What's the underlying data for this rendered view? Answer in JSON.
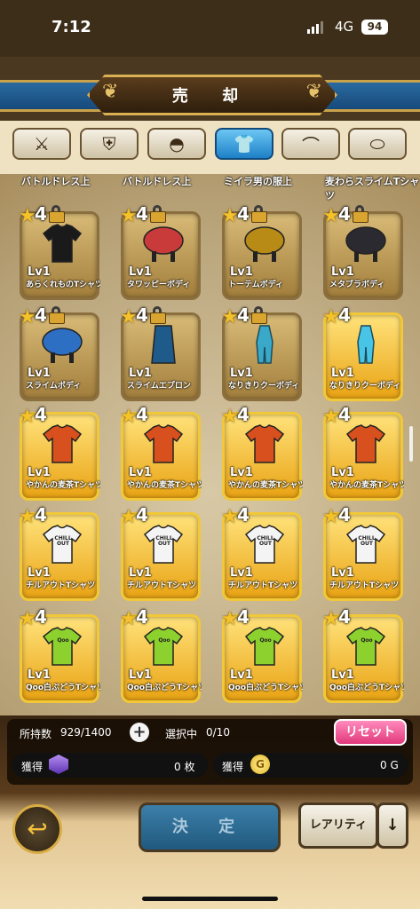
{
  "status": {
    "time": "7:12",
    "network": "4G",
    "battery": "94"
  },
  "header": {
    "title": "売 却"
  },
  "tabs": [
    {
      "icon": "sword-icon",
      "glyph": "⚔",
      "active": false
    },
    {
      "icon": "shield-icon",
      "glyph": "⛨",
      "active": false
    },
    {
      "icon": "helmet-icon",
      "glyph": "◓",
      "active": false
    },
    {
      "icon": "shirt-icon",
      "glyph": "👕",
      "active": true
    },
    {
      "icon": "pants-icon",
      "glyph": "⌒",
      "active": false
    },
    {
      "icon": "accessory-icon",
      "glyph": "⬭",
      "active": false
    }
  ],
  "partial_row": [
    "バトルドレス上",
    "バトルドレス上",
    "ミイラ男の服上",
    "麦わらスライムTシャツ"
  ],
  "items": [
    {
      "rarity": "4",
      "locked": true,
      "level": "Lv1",
      "name": "あらくれものTシャツ",
      "color": "#1a1a1a",
      "icon": "shirt-icon"
    },
    {
      "rarity": "4",
      "locked": true,
      "level": "Lv1",
      "name": "タワッピーボディ",
      "color": "#c93a3a",
      "icon": "body-icon"
    },
    {
      "rarity": "4",
      "locked": true,
      "level": "Lv1",
      "name": "トーテムボディ",
      "color": "#b88a16",
      "icon": "body-icon"
    },
    {
      "rarity": "4",
      "locked": true,
      "level": "Lv1",
      "name": "メタブラボディ",
      "color": "#2a2a30",
      "icon": "body-icon"
    },
    {
      "rarity": "4",
      "locked": true,
      "level": "Lv1",
      "name": "スライムボディ",
      "color": "#2d6fc2",
      "icon": "body-icon"
    },
    {
      "rarity": "4",
      "locked": true,
      "level": "Lv1",
      "name": "スライムエプロン",
      "color": "#1f5b8a",
      "icon": "apron-icon"
    },
    {
      "rarity": "4",
      "locked": true,
      "level": "Lv1",
      "name": "なりきりクーボディ",
      "color": "#3aa8c9",
      "icon": "suit-icon"
    },
    {
      "rarity": "4",
      "locked": false,
      "level": "Lv1",
      "name": "なりきりクーボディ",
      "color": "#48c4e6",
      "icon": "suit-icon"
    },
    {
      "rarity": "4",
      "locked": false,
      "level": "Lv1",
      "name": "やかんの麦茶Tシャツ",
      "color": "#d8501e",
      "icon": "shirt-icon"
    },
    {
      "rarity": "4",
      "locked": false,
      "level": "Lv1",
      "name": "やかんの麦茶Tシャツ",
      "color": "#d8501e",
      "icon": "shirt-icon"
    },
    {
      "rarity": "4",
      "locked": false,
      "level": "Lv1",
      "name": "やかんの麦茶Tシャツ",
      "color": "#d8501e",
      "icon": "shirt-icon"
    },
    {
      "rarity": "4",
      "locked": false,
      "level": "Lv1",
      "name": "やかんの麦茶Tシャツ",
      "color": "#d8501e",
      "icon": "shirt-icon"
    },
    {
      "rarity": "4",
      "locked": false,
      "level": "Lv1",
      "name": "チルアウトTシャツ",
      "color": "#f4f4f4",
      "icon": "shirt-icon",
      "print": "CHILL OUT"
    },
    {
      "rarity": "4",
      "locked": false,
      "level": "Lv1",
      "name": "チルアウトTシャツ",
      "color": "#f4f4f4",
      "icon": "shirt-icon",
      "print": "CHILL OUT"
    },
    {
      "rarity": "4",
      "locked": false,
      "level": "Lv1",
      "name": "チルアウトTシャツ",
      "color": "#f4f4f4",
      "icon": "shirt-icon",
      "print": "CHILL OUT"
    },
    {
      "rarity": "4",
      "locked": false,
      "level": "Lv1",
      "name": "チルアウトTシャツ",
      "color": "#f4f4f4",
      "icon": "shirt-icon",
      "print": "CHILL OUT"
    },
    {
      "rarity": "4",
      "locked": false,
      "level": "Lv1",
      "name": "Qoo白ぶどうTシャツ",
      "color": "#8dd12e",
      "icon": "shirt-icon",
      "print": "Qoo"
    },
    {
      "rarity": "4",
      "locked": false,
      "level": "Lv1",
      "name": "Qoo白ぶどうTシャツ",
      "color": "#8dd12e",
      "icon": "shirt-icon",
      "print": "Qoo"
    },
    {
      "rarity": "4",
      "locked": false,
      "level": "Lv1",
      "name": "Qoo白ぶどうTシャツ",
      "color": "#8dd12e",
      "icon": "shirt-icon",
      "print": "Qoo"
    },
    {
      "rarity": "4",
      "locked": false,
      "level": "Lv1",
      "name": "Qoo白ぶどうTシャツ",
      "color": "#8dd12e",
      "icon": "shirt-icon",
      "print": "Qoo"
    }
  ],
  "footer": {
    "owned_label": "所持数",
    "owned_value": "929/1400",
    "selected_label": "選択中",
    "selected_value": "0/10",
    "reset_label": "リセット",
    "gain_label": "獲得",
    "gem_value": "0 枚",
    "gold_value": "0 G",
    "gold_symbol": "G",
    "decide_label": "決 定",
    "rarity_label": "レアリティ",
    "arrow": "↓",
    "back_glyph": "↩"
  }
}
